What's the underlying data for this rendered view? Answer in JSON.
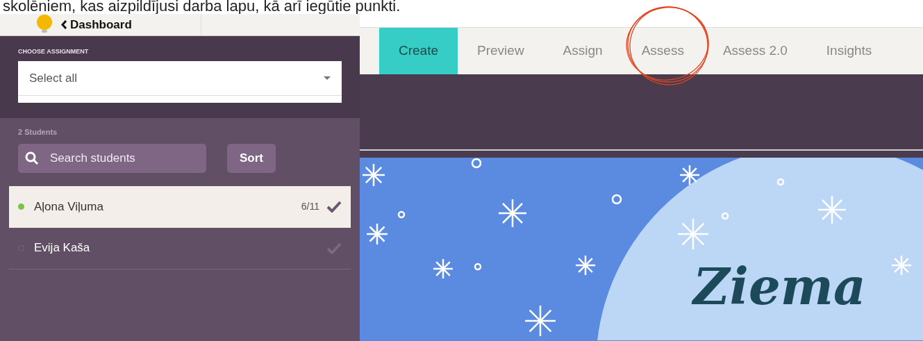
{
  "document_text": "skolēniem, kas aizpildījusi darba lapu, kā arī iegūtie punkti.",
  "header": {
    "back_link": "Dashboard"
  },
  "assignment": {
    "label": "CHOOSE ASSIGNMENT",
    "value": "Select all"
  },
  "students": {
    "count_label": "2 Students",
    "search_placeholder": "Search students",
    "sort_button": "Sort",
    "items": [
      {
        "name": "Aļona Viļuma",
        "score": "6/11",
        "selected": true,
        "submitted": true
      },
      {
        "name": "Evija Kaša",
        "selected": false,
        "submitted": false
      }
    ]
  },
  "tabs": [
    {
      "label": "Create",
      "selected": true,
      "circled": false
    },
    {
      "label": "Preview",
      "selected": false,
      "circled": false
    },
    {
      "label": "Assign",
      "selected": false,
      "circled": false
    },
    {
      "label": "Assess",
      "selected": false,
      "circled": true
    },
    {
      "label": "Assess 2.0",
      "selected": false,
      "circled": false
    },
    {
      "label": "Insights",
      "selected": false,
      "circled": false
    }
  ],
  "worksheet": {
    "title": "Ziema"
  }
}
